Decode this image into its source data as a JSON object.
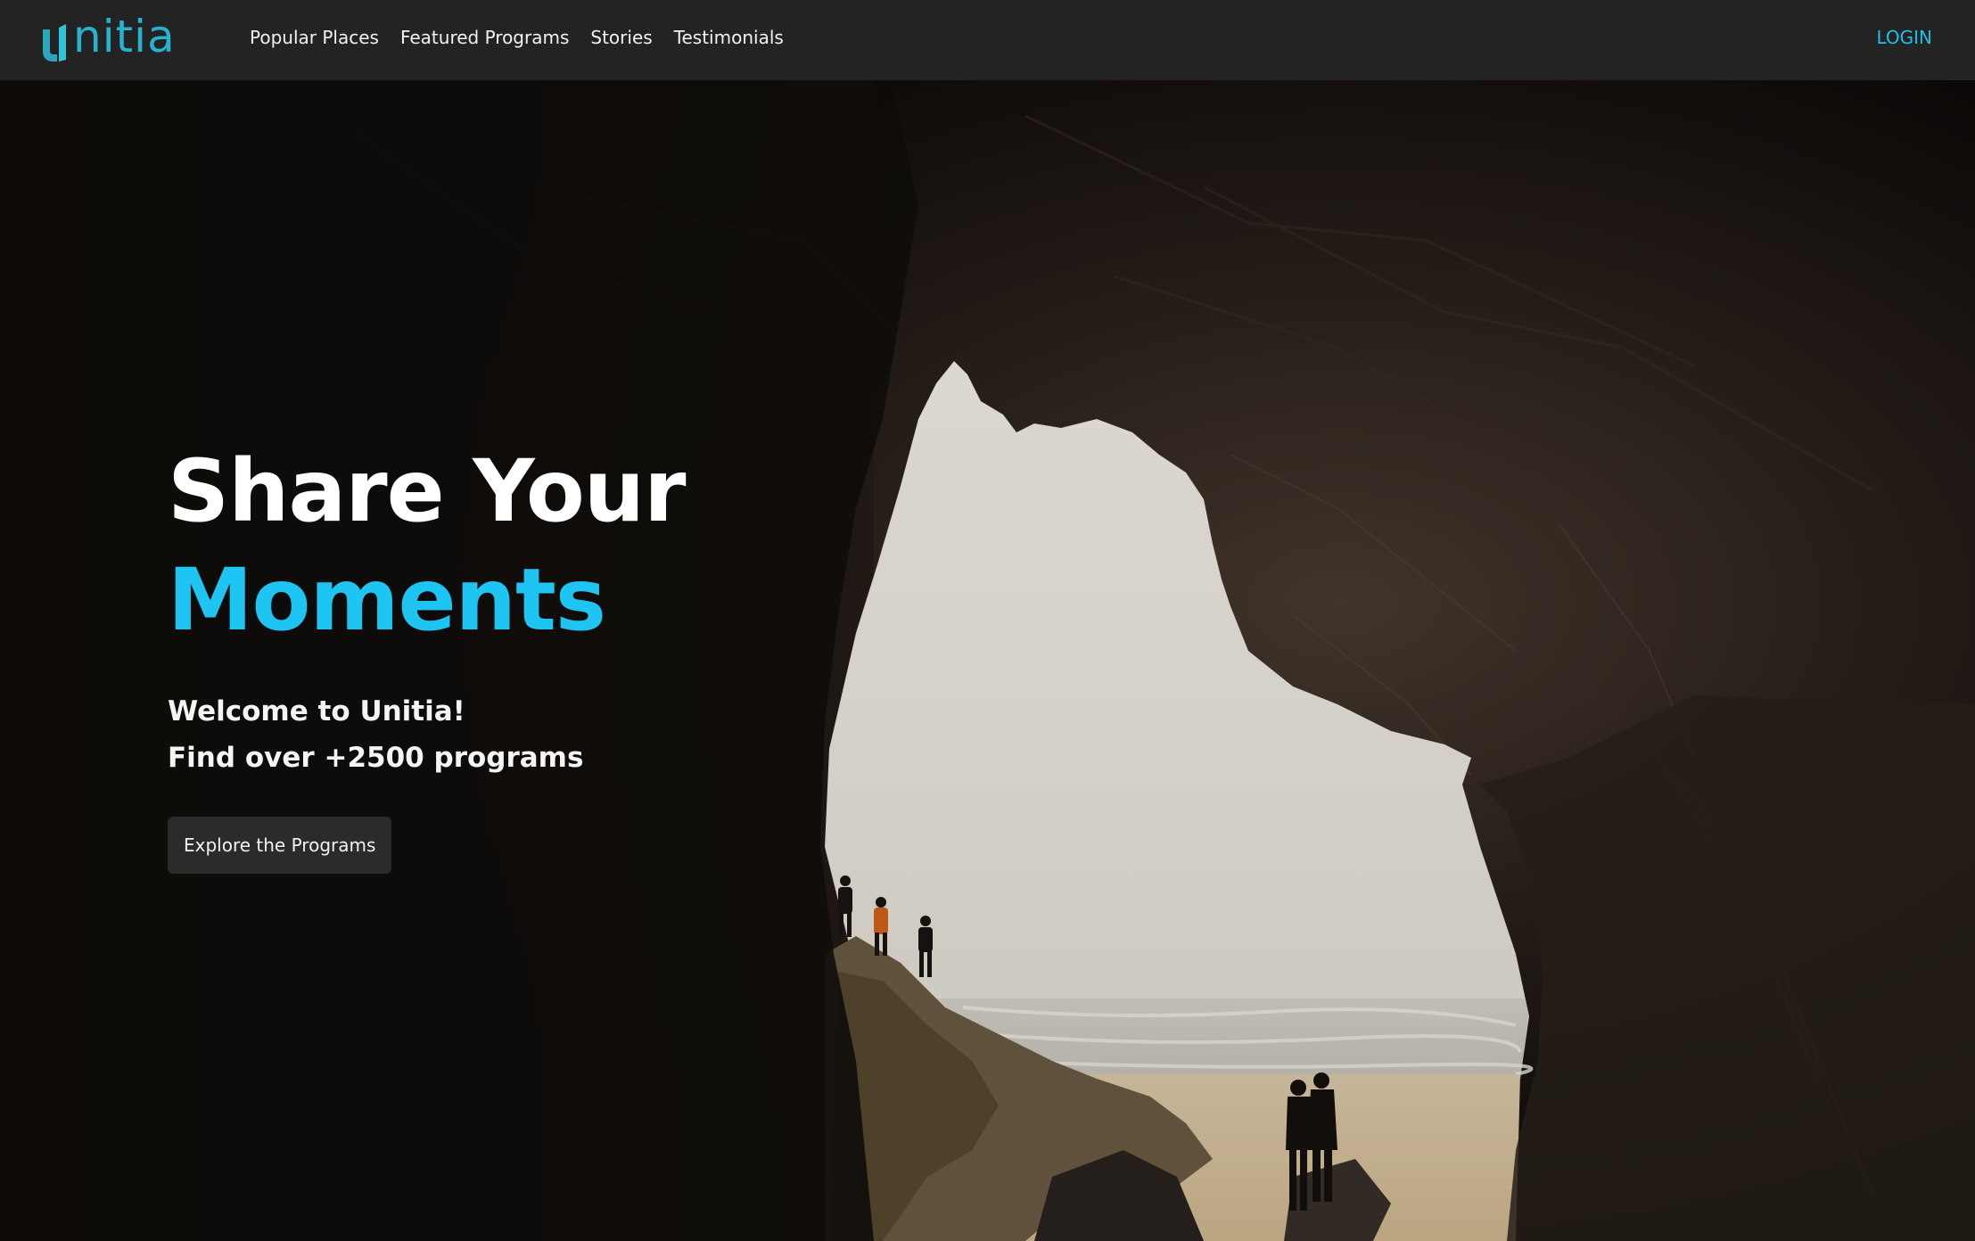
{
  "brand": {
    "name": "nitia",
    "color": "#26b3cf"
  },
  "nav": {
    "links": [
      {
        "label": "Popular Places"
      },
      {
        "label": "Featured Programs"
      },
      {
        "label": "Stories"
      },
      {
        "label": "Testimonials"
      }
    ],
    "login_label": "LOGIN",
    "login_color": "#1fbfe8"
  },
  "hero": {
    "headline_line1": "Share Your",
    "headline_line2": "Moments",
    "headline_accent_color": "#1ec4f2",
    "welcome": "Welcome to Unitia!",
    "tagline": "Find over +2500 programs",
    "cta_label": "Explore the Programs",
    "background_scene": "cave-opening-to-beach-photo"
  }
}
